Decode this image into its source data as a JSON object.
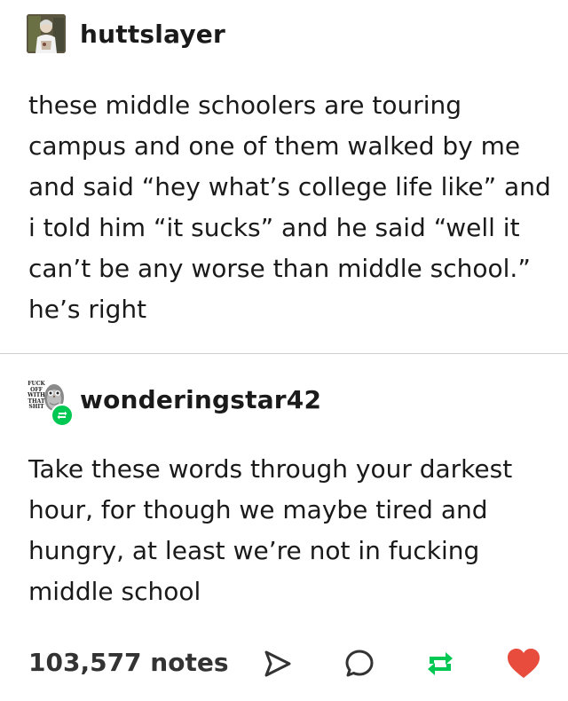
{
  "posts": [
    {
      "username": "huttslayer",
      "text": "these middle schoolers are touring campus and one of them walked by me and said “hey what’s college life like” and i told him “it sucks” and he said “well it can’t be any worse than middle school.” he’s right"
    },
    {
      "username": "wonderingstar42",
      "text": "Take these words through your darkest hour, for though we maybe tired and hungry, at least we’re not in fucking middle school",
      "avatar_caption": "FUCK OFF WITH THAT SHIT"
    }
  ],
  "footer": {
    "notes": "103,577 notes",
    "icons": [
      "share-icon",
      "reply-icon",
      "reblog-icon",
      "heart-icon"
    ]
  },
  "colors": {
    "reblog_green": "#00c853",
    "like_red": "#e74c3c",
    "text": "#1a1a1a"
  }
}
